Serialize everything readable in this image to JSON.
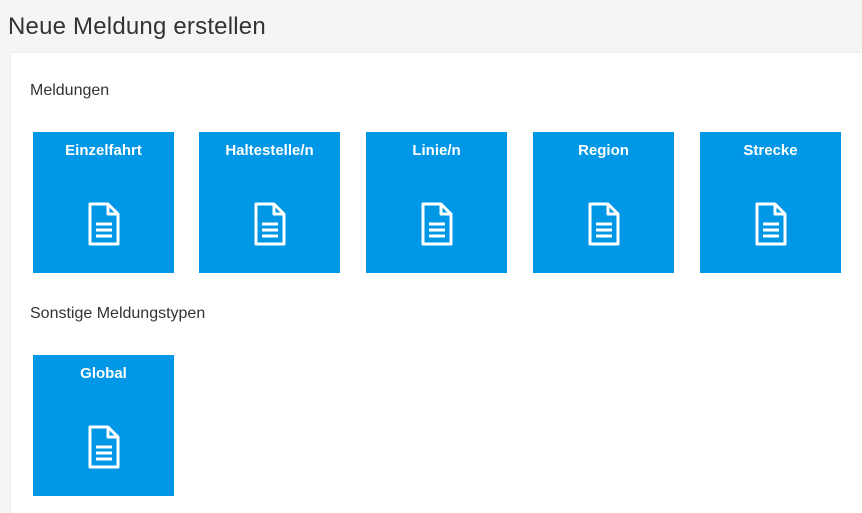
{
  "header": {
    "title": "Neue Meldung erstellen"
  },
  "sections": [
    {
      "label": "Meldungen",
      "tiles": [
        {
          "label": "Einzelfahrt",
          "icon": "document-icon"
        },
        {
          "label": "Haltestelle/n",
          "icon": "document-icon"
        },
        {
          "label": "Linie/n",
          "icon": "document-icon"
        },
        {
          "label": "Region",
          "icon": "document-icon"
        },
        {
          "label": "Strecke",
          "icon": "document-icon"
        }
      ]
    },
    {
      "label": "Sonstige Meldungstypen",
      "tiles": [
        {
          "label": "Global",
          "icon": "document-icon"
        }
      ]
    }
  ],
  "colors": {
    "tile_background": "#0097e6",
    "tile_text": "#ffffff",
    "page_background": "#f5f5f5",
    "panel_background": "#ffffff",
    "text": "#333333"
  }
}
